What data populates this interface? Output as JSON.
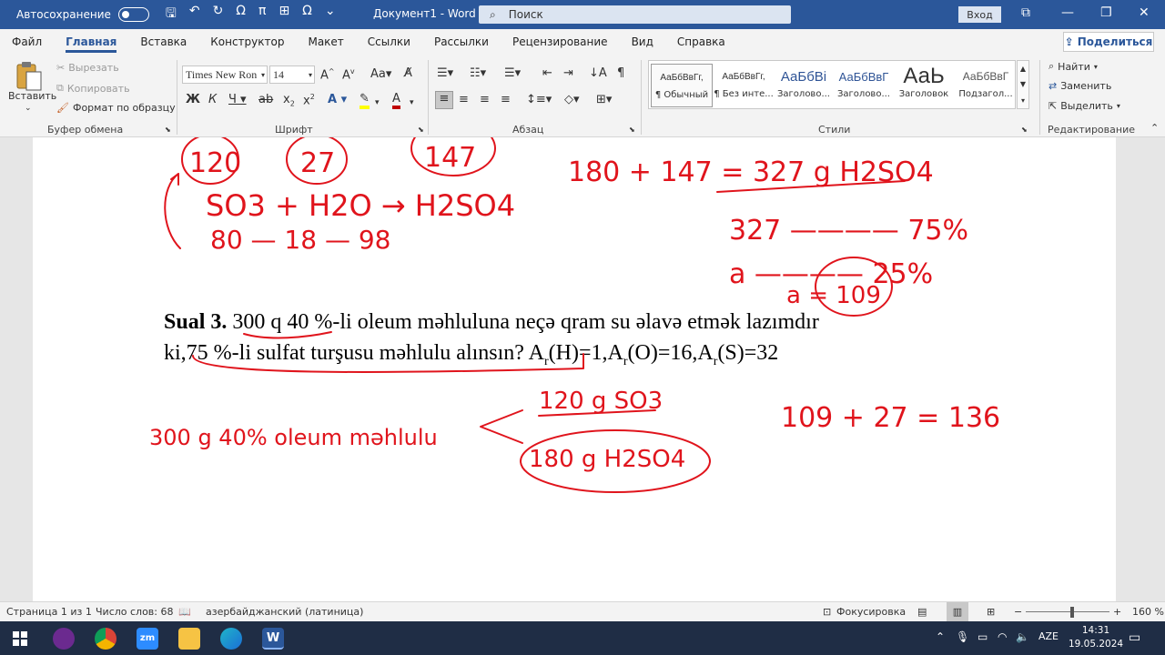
{
  "titlebar": {
    "autosave_label": "Автосохранение",
    "document_title": "Документ1 - Word",
    "search_placeholder": "Поиск",
    "signin_label": "Вход"
  },
  "ribbon_tabs": [
    "Файл",
    "Главная",
    "Вставка",
    "Конструктор",
    "Макет",
    "Ссылки",
    "Рассылки",
    "Рецензирование",
    "Вид",
    "Справка"
  ],
  "active_tab": "Главная",
  "share_label": "Поделиться",
  "clipboard": {
    "paste_label": "Вставить",
    "cut_label": "Вырезать",
    "copy_label": "Копировать",
    "format_painter_label": "Формат по образцу",
    "group_label": "Буфер обмена"
  },
  "font": {
    "font_name": "Times New Ron",
    "font_size": "14",
    "group_label": "Шрифт"
  },
  "paragraph": {
    "group_label": "Абзац"
  },
  "styles": {
    "group_label": "Стили",
    "items": [
      {
        "preview": "АаБбВвГг,",
        "name": "¶ Обычный"
      },
      {
        "preview": "АаБбВвГг,",
        "name": "¶ Без инте..."
      },
      {
        "preview": "АаБбВі",
        "name": "Заголово..."
      },
      {
        "preview": "АаБбВвГ",
        "name": "Заголово..."
      },
      {
        "preview": "АаЬ",
        "name": "Заголовок"
      },
      {
        "preview": "АаБбВвГ",
        "name": "Подзагол..."
      }
    ]
  },
  "editing": {
    "find_label": "Найти",
    "replace_label": "Заменить",
    "select_label": "Выделить",
    "group_label": "Редактирование"
  },
  "document": {
    "question_bold": "Sual 3.",
    "question_line1": " 300 q 40 %-li oleum məhluluna neçə qram su əlavə etmək lazımdır",
    "question_line2_a": "ki,75 %-li sulfat turşusu məhlulu alınsın? A",
    "sub_r": "r",
    "formula_h": "(H)=1,A",
    "formula_o": "(O)=16,A",
    "formula_s": "(S)=32",
    "handwriting": {
      "top_120": "120",
      "top_27": "27",
      "top_147": "147",
      "eq1": "SO3 + H2O → H2SO4",
      "masses": "80 — 18 — 98",
      "sum": "180 + 147 = 327 g H2SO4",
      "r1": "327 ———— 75%",
      "r2": "a ———— 25%",
      "a_val": "a = 109",
      "sum2": "109 + 27 = 136",
      "oleum": "300 g 40% oleum məhlulu",
      "b1": "120 g SO3",
      "b2": "180 g H2SO4"
    }
  },
  "statusbar": {
    "page": "Страница 1 из 1",
    "words": "Число слов: 68",
    "language": "азербайджанский (латиница)",
    "focus": "Фокусировка",
    "zoom": "160 %"
  },
  "taskbar": {
    "language": "AZE",
    "time": "14:31",
    "date": "19.05.2024"
  }
}
